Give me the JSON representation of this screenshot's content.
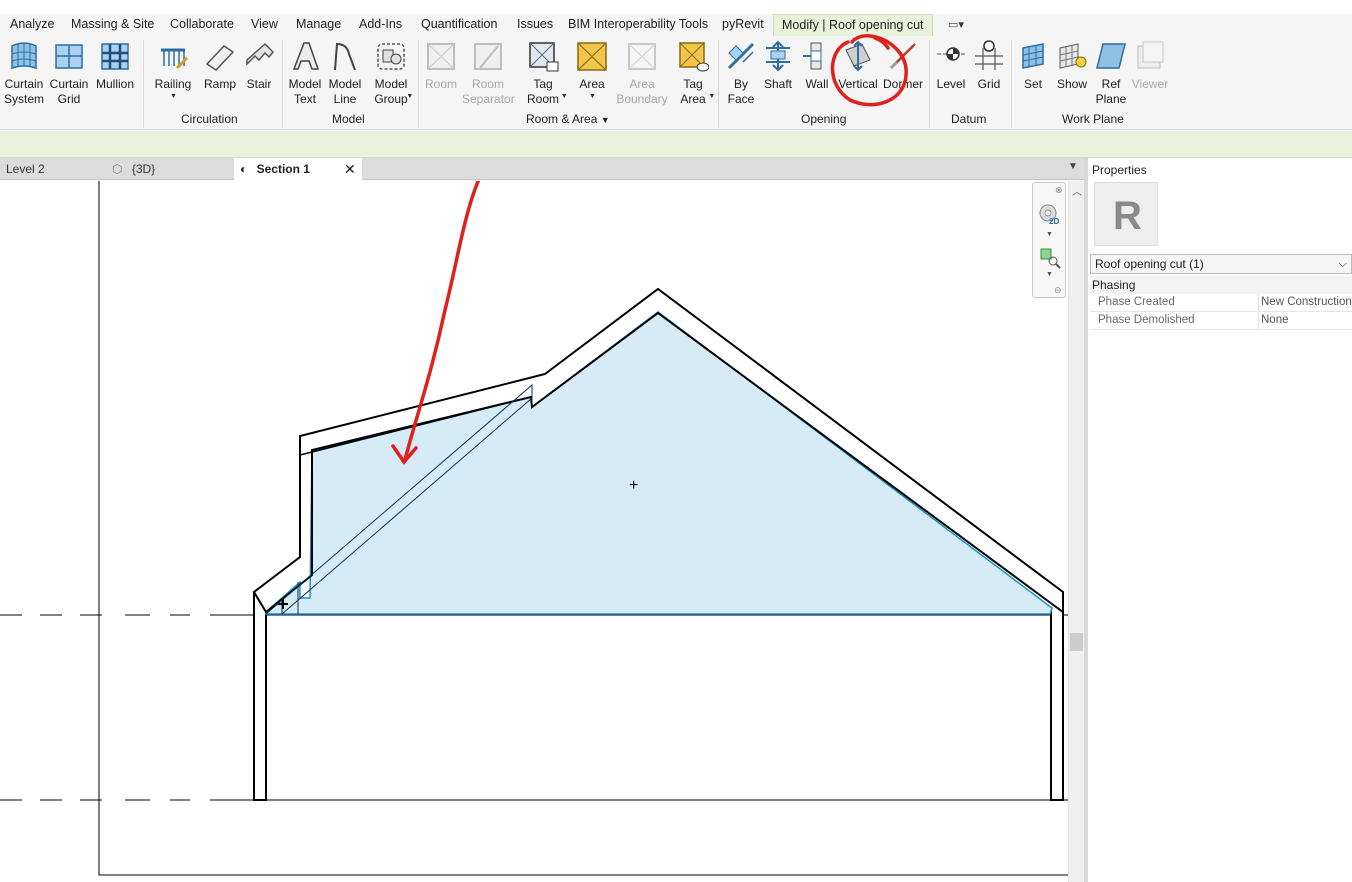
{
  "menu": {
    "tabs": [
      "Analyze",
      "Massing & Site",
      "Collaborate",
      "View",
      "Manage",
      "Add-Ins",
      "Quantification",
      "Issues",
      "BIM Interoperability Tools",
      "pyRevit"
    ],
    "active_tab": "Modify | Roof opening cut"
  },
  "ribbon": {
    "build": {
      "curtain_system": "Curtain\nSystem",
      "curtain_grid": "Curtain\nGrid",
      "mullion": "Mullion"
    },
    "circulation": {
      "title": "Circulation",
      "railing": "Railing",
      "ramp": "Ramp",
      "stair": "Stair"
    },
    "model": {
      "title": "Model",
      "model_text": "Model\nText",
      "model_line": "Model\nLine",
      "model_group": "Model\nGroup"
    },
    "room_area": {
      "title": "Room & Area",
      "room": "Room",
      "room_separator": "Room\nSeparator",
      "tag_room": "Tag\nRoom",
      "area": "Area",
      "area_boundary": "Area\nBoundary",
      "tag_area": "Tag\nArea"
    },
    "opening": {
      "title": "Opening",
      "by_face": "By\nFace",
      "shaft": "Shaft",
      "wall": "Wall",
      "vertical": "Vertical",
      "dormer": "Dormer"
    },
    "datum": {
      "title": "Datum",
      "level": "Level",
      "grid": "Grid"
    },
    "work_plane": {
      "title": "Work Plane",
      "set": "Set",
      "show": "Show",
      "ref_plane": "Ref\nPlane",
      "viewer": "Viewer"
    }
  },
  "view_tabs": [
    {
      "label": "Level 2",
      "active": false
    },
    {
      "label": "{3D}",
      "active": false
    },
    {
      "label": "Section 1",
      "active": true
    }
  ],
  "properties": {
    "title": "Properties",
    "type_selector": "Roof opening cut (1)",
    "group": "Phasing",
    "rows": [
      {
        "name": "Phase Created",
        "value": "New Construction"
      },
      {
        "name": "Phase Demolished",
        "value": "None"
      }
    ]
  },
  "navbar": {
    "label_2d": "2D"
  },
  "colors": {
    "accent_tab": "#e9f3d9",
    "selection_fill": "#d6ebf5",
    "selection_stroke": "#1e90c8",
    "annotation_red": "#e0201b"
  }
}
